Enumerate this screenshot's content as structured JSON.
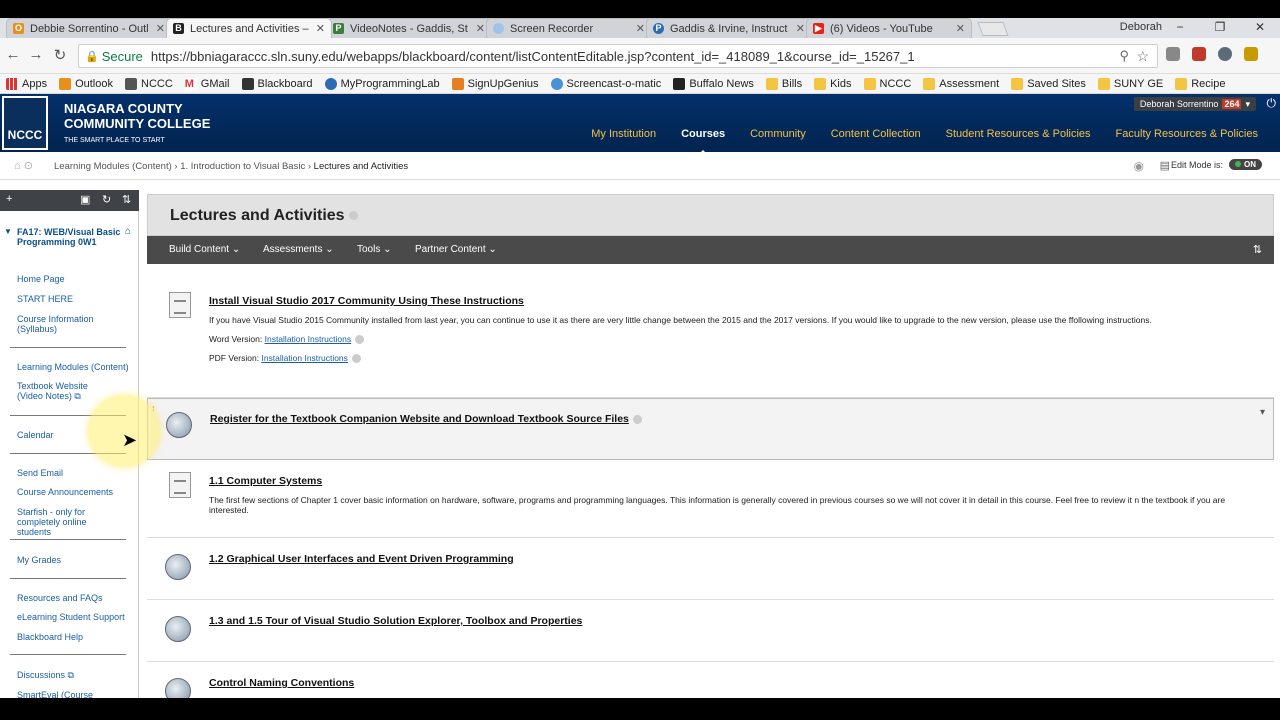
{
  "browser": {
    "tabs": [
      {
        "title": "Debbie Sorrentino - Outl",
        "fav": "O",
        "color": "#e6901f"
      },
      {
        "title": "Lectures and Activities –",
        "fav": "B",
        "color": "#222222"
      },
      {
        "title": "VideoNotes - Gaddis, St",
        "fav": "P",
        "color": "#3b7d3b"
      },
      {
        "title": "Screen Recorder",
        "fav": "",
        "color": "#9ec5e8"
      },
      {
        "title": "Gaddis & Irvine, Instruct",
        "fav": "P",
        "color": "#2a6db5"
      },
      {
        "title": "(6) Videos - YouTube",
        "fav": "",
        "color": "#e62117"
      }
    ],
    "user": "Deborah",
    "min": "−",
    "max": "❐",
    "close": "✕",
    "secure_label": "Secure",
    "url": "https://bbniagaraccc.sln.suny.edu/webapps/blackboard/content/listContentEditable.jsp?content_id=_418089_1&course_id=_15267_1",
    "bookmarks": [
      "Apps",
      "Outlook",
      "NCCC",
      "GMail",
      "Blackboard",
      "MyProgrammingLab",
      "SignUpGenius",
      "Screencast-o-matic",
      "Buffalo News",
      "Bills",
      "Kids",
      "NCCC",
      "Assessment",
      "Saved Sites",
      "SUNY GE",
      "Recipe"
    ]
  },
  "header": {
    "college_line1": "NIAGARA COUNTY",
    "college_line2": "COMMUNITY COLLEGE",
    "tagline": "THE SMART PLACE TO START",
    "seal_text": "NCCC",
    "user_name": "Deborah Sorrentino",
    "notif_count": "264",
    "nav": [
      "My Institution",
      "Courses",
      "Community",
      "Content Collection",
      "Student Resources & Policies",
      "Faculty Resources & Policies"
    ]
  },
  "breadcrumb": {
    "items": [
      "Learning Modules (Content)",
      "1. Introduction to Visual Basic",
      "Lectures and Activities"
    ],
    "edit_mode_label": "Edit Mode is:",
    "edit_mode_value": "ON"
  },
  "sidebar": {
    "course_title": "FA17: WEB/Visual Basic Programming 0W1",
    "items": [
      "Home Page",
      "START HERE",
      "Course Information (Syllabus)",
      "Learning Modules (Content)",
      "Textbook Website (Video Notes)",
      "Calendar",
      "Send Email",
      "Course Announcements",
      "Starfish - only for completely online students",
      "My Grades",
      "Resources and FAQs",
      "eLearning Student Support",
      "Blackboard Help",
      "Discussions",
      "SmartEval (Course Evaluation)"
    ]
  },
  "main": {
    "title": "Lectures and Activities",
    "actions": [
      "Build Content",
      "Assessments",
      "Tools",
      "Partner Content"
    ],
    "items": [
      {
        "title": "Install Visual Studio 2017 Community Using These Instructions",
        "desc": "If you have Visual Studio 2015 Community installed from last year, you can continue to use it as there are very little change between the 2015 and the 2017 versions.  If you would like to upgrade to the new version, please use the ffollowing instructions.",
        "word_label": "Word Version:",
        "pdf_label": "PDF Version:",
        "link": "Installation Instructions"
      },
      {
        "title": "Register for the Textbook Companion Website and Download Textbook Source Files"
      },
      {
        "title": "1.1 Computer Systems",
        "desc": "The first few sections of Chapter 1 cover basic information on hardware, software, programs and programming languages.  This information is generally covered in previous courses so we will not cover it in detail in this course.  Feel free to review it n the textbook if you are interested."
      },
      {
        "title": "1.2 Graphical User Interfaces and Event Driven Programming"
      },
      {
        "title": "1.3 and 1.5 Tour of Visual Studio Solution Explorer, Toolbox and Properties"
      },
      {
        "title": "Control Naming Conventions"
      }
    ]
  }
}
